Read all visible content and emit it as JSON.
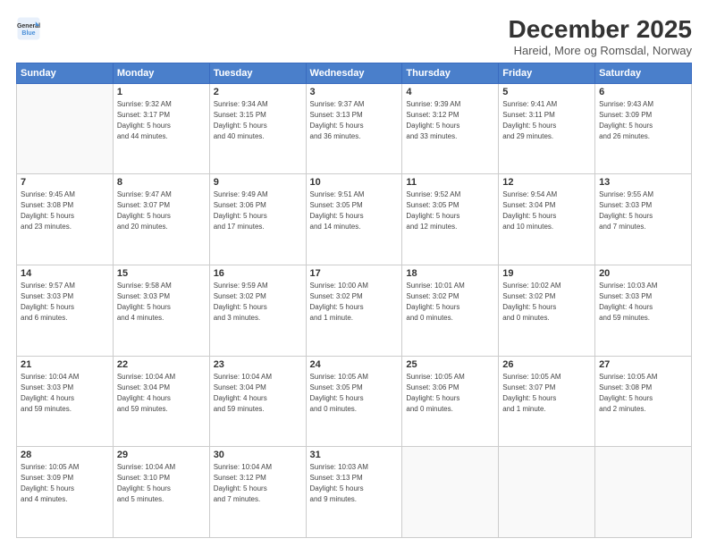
{
  "header": {
    "logo_line1": "General",
    "logo_line2": "Blue",
    "title": "December 2025",
    "subtitle": "Hareid, More og Romsdal, Norway"
  },
  "days_of_week": [
    "Sunday",
    "Monday",
    "Tuesday",
    "Wednesday",
    "Thursday",
    "Friday",
    "Saturday"
  ],
  "weeks": [
    [
      {
        "day": "",
        "info": ""
      },
      {
        "day": "1",
        "info": "Sunrise: 9:32 AM\nSunset: 3:17 PM\nDaylight: 5 hours\nand 44 minutes."
      },
      {
        "day": "2",
        "info": "Sunrise: 9:34 AM\nSunset: 3:15 PM\nDaylight: 5 hours\nand 40 minutes."
      },
      {
        "day": "3",
        "info": "Sunrise: 9:37 AM\nSunset: 3:13 PM\nDaylight: 5 hours\nand 36 minutes."
      },
      {
        "day": "4",
        "info": "Sunrise: 9:39 AM\nSunset: 3:12 PM\nDaylight: 5 hours\nand 33 minutes."
      },
      {
        "day": "5",
        "info": "Sunrise: 9:41 AM\nSunset: 3:11 PM\nDaylight: 5 hours\nand 29 minutes."
      },
      {
        "day": "6",
        "info": "Sunrise: 9:43 AM\nSunset: 3:09 PM\nDaylight: 5 hours\nand 26 minutes."
      }
    ],
    [
      {
        "day": "7",
        "info": "Sunrise: 9:45 AM\nSunset: 3:08 PM\nDaylight: 5 hours\nand 23 minutes."
      },
      {
        "day": "8",
        "info": "Sunrise: 9:47 AM\nSunset: 3:07 PM\nDaylight: 5 hours\nand 20 minutes."
      },
      {
        "day": "9",
        "info": "Sunrise: 9:49 AM\nSunset: 3:06 PM\nDaylight: 5 hours\nand 17 minutes."
      },
      {
        "day": "10",
        "info": "Sunrise: 9:51 AM\nSunset: 3:05 PM\nDaylight: 5 hours\nand 14 minutes."
      },
      {
        "day": "11",
        "info": "Sunrise: 9:52 AM\nSunset: 3:05 PM\nDaylight: 5 hours\nand 12 minutes."
      },
      {
        "day": "12",
        "info": "Sunrise: 9:54 AM\nSunset: 3:04 PM\nDaylight: 5 hours\nand 10 minutes."
      },
      {
        "day": "13",
        "info": "Sunrise: 9:55 AM\nSunset: 3:03 PM\nDaylight: 5 hours\nand 7 minutes."
      }
    ],
    [
      {
        "day": "14",
        "info": "Sunrise: 9:57 AM\nSunset: 3:03 PM\nDaylight: 5 hours\nand 6 minutes."
      },
      {
        "day": "15",
        "info": "Sunrise: 9:58 AM\nSunset: 3:03 PM\nDaylight: 5 hours\nand 4 minutes."
      },
      {
        "day": "16",
        "info": "Sunrise: 9:59 AM\nSunset: 3:02 PM\nDaylight: 5 hours\nand 3 minutes."
      },
      {
        "day": "17",
        "info": "Sunrise: 10:00 AM\nSunset: 3:02 PM\nDaylight: 5 hours\nand 1 minute."
      },
      {
        "day": "18",
        "info": "Sunrise: 10:01 AM\nSunset: 3:02 PM\nDaylight: 5 hours\nand 0 minutes."
      },
      {
        "day": "19",
        "info": "Sunrise: 10:02 AM\nSunset: 3:02 PM\nDaylight: 5 hours\nand 0 minutes."
      },
      {
        "day": "20",
        "info": "Sunrise: 10:03 AM\nSunset: 3:03 PM\nDaylight: 4 hours\nand 59 minutes."
      }
    ],
    [
      {
        "day": "21",
        "info": "Sunrise: 10:04 AM\nSunset: 3:03 PM\nDaylight: 4 hours\nand 59 minutes."
      },
      {
        "day": "22",
        "info": "Sunrise: 10:04 AM\nSunset: 3:04 PM\nDaylight: 4 hours\nand 59 minutes."
      },
      {
        "day": "23",
        "info": "Sunrise: 10:04 AM\nSunset: 3:04 PM\nDaylight: 4 hours\nand 59 minutes."
      },
      {
        "day": "24",
        "info": "Sunrise: 10:05 AM\nSunset: 3:05 PM\nDaylight: 5 hours\nand 0 minutes."
      },
      {
        "day": "25",
        "info": "Sunrise: 10:05 AM\nSunset: 3:06 PM\nDaylight: 5 hours\nand 0 minutes."
      },
      {
        "day": "26",
        "info": "Sunrise: 10:05 AM\nSunset: 3:07 PM\nDaylight: 5 hours\nand 1 minute."
      },
      {
        "day": "27",
        "info": "Sunrise: 10:05 AM\nSunset: 3:08 PM\nDaylight: 5 hours\nand 2 minutes."
      }
    ],
    [
      {
        "day": "28",
        "info": "Sunrise: 10:05 AM\nSunset: 3:09 PM\nDaylight: 5 hours\nand 4 minutes."
      },
      {
        "day": "29",
        "info": "Sunrise: 10:04 AM\nSunset: 3:10 PM\nDaylight: 5 hours\nand 5 minutes."
      },
      {
        "day": "30",
        "info": "Sunrise: 10:04 AM\nSunset: 3:12 PM\nDaylight: 5 hours\nand 7 minutes."
      },
      {
        "day": "31",
        "info": "Sunrise: 10:03 AM\nSunset: 3:13 PM\nDaylight: 5 hours\nand 9 minutes."
      },
      {
        "day": "",
        "info": ""
      },
      {
        "day": "",
        "info": ""
      },
      {
        "day": "",
        "info": ""
      }
    ]
  ]
}
